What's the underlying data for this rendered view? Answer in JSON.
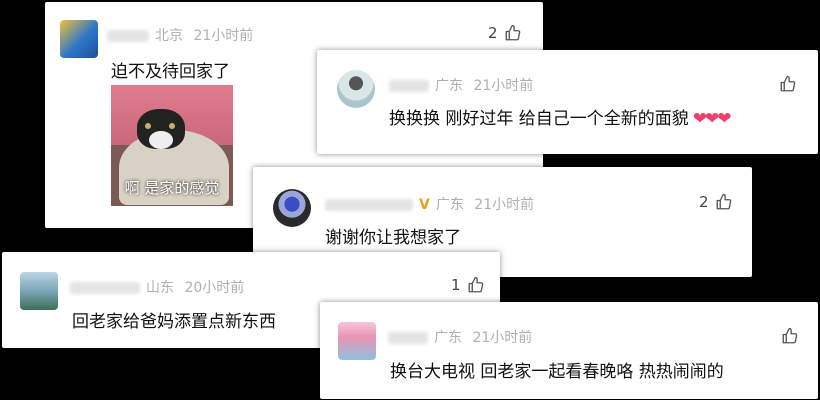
{
  "comments": [
    {
      "location": "北京",
      "time": "21小时前",
      "likes": "2",
      "text": "迫不及待回家了",
      "sticker_caption": "啊 是家的感觉"
    },
    {
      "location": "广东",
      "time": "21小时前",
      "likes": "",
      "text": "换换换 刚好过年 给自己一个全新的面貌",
      "hearts": "❤❤❤"
    },
    {
      "location": "广东",
      "time": "21小时前",
      "likes": "2",
      "text": "谢谢你让我想家了",
      "badge": "V"
    },
    {
      "location": "山东",
      "time": "20小时前",
      "likes": "1",
      "text": "回老家给爸妈添置点新东西"
    },
    {
      "location": "广东",
      "time": "21小时前",
      "likes": "",
      "text": "换台大电视 回老家一起看春晚咯 热热闹闹的"
    }
  ],
  "icons": {
    "like": "thumbs-up-icon"
  },
  "colors": {
    "meta": "#b0b0b0",
    "heart": "#ef3f6b",
    "background": "#000000"
  }
}
